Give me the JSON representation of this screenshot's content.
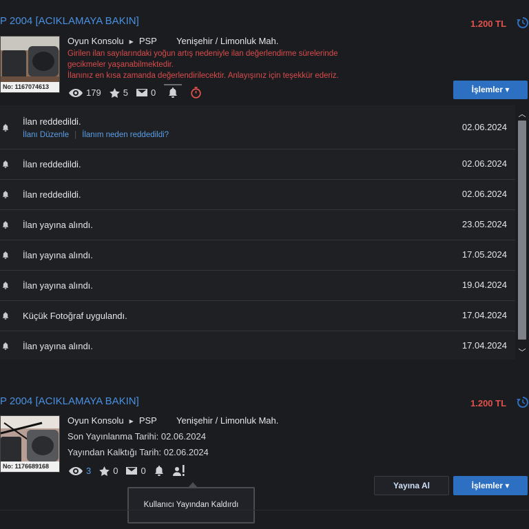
{
  "listing1": {
    "title": "P 2004 [ACIKLAMAYA BAKIN]",
    "price": "1.200 TL",
    "listing_no": "No: 1167074613",
    "category": "Oyun Konsolu",
    "subcategory": "PSP",
    "location": "Yenişehir / Limonluk Mah.",
    "warning_lines": [
      "Girilen ilan sayılarındaki yoğun artış nedeniyle ilan değerlendirme sürelerinde",
      "gecikmeler yaşanabilmektedir.",
      "İlanınız en kısa zamanda değerlendirilecektir. Anlayışınız için teşekkür ederiz."
    ],
    "views": "179",
    "favorites": "5",
    "messages": "0",
    "actions_label": "İşlemler ▾"
  },
  "history": {
    "rows": [
      {
        "text": "İlan reddedildi.",
        "date": "02.06.2024",
        "link_edit": "İlanı Düzenle",
        "link_reason": "İlanım neden reddedildi?"
      },
      {
        "text": "İlan reddedildi.",
        "date": "02.06.2024"
      },
      {
        "text": "İlan reddedildi.",
        "date": "02.06.2024"
      },
      {
        "text": "İlan yayına alındı.",
        "date": "23.05.2024"
      },
      {
        "text": "İlan yayına alındı.",
        "date": "17.05.2024"
      },
      {
        "text": "İlan yayına alındı.",
        "date": "19.04.2024"
      },
      {
        "text": "Küçük Fotoğraf uygulandı.",
        "date": "17.04.2024"
      },
      {
        "text": "İlan yayına alındı.",
        "date": "17.04.2024"
      }
    ]
  },
  "listing2": {
    "title": "P 2004 [ACIKLAMAYA BAKIN]",
    "price": "1.200 TL",
    "listing_no": "No: 1176689168",
    "category": "Oyun Konsolu",
    "subcategory": "PSP",
    "location": "Yenişehir / Limonluk Mah.",
    "last_published": "Son Yayınlanma Tarihi: 02.06.2024",
    "unpublished": "Yayından Kalktığı Tarih: 02.06.2024",
    "views": "3",
    "favorites": "0",
    "messages": "0",
    "publish_label": "Yayına Al",
    "actions_label": "İşlemler ▾",
    "tooltip": "Kullanıcı Yayından Kaldırdı"
  },
  "colors": {
    "link_blue": "#4a90e2",
    "price_red": "#e0524c",
    "warning_red": "#d94c4c",
    "button_blue": "#2d6fc0",
    "background": "#1b1c1f"
  }
}
